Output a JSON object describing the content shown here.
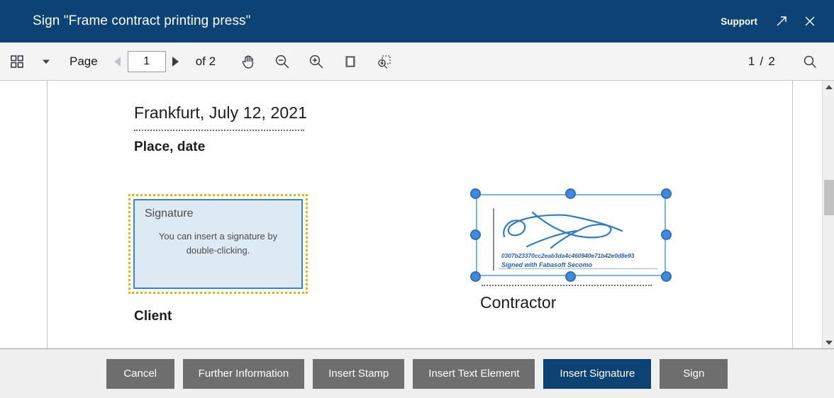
{
  "window": {
    "title": "Sign \"Frame contract printing press\"",
    "support_label": "Support",
    "popout_icon": "external-link-icon",
    "close_icon": "close-icon",
    "accent_color": "#0b4375"
  },
  "toolbar": {
    "grid_icon": "thumbnail-grid-icon",
    "dropdown_icon": "chevron-down-icon",
    "page_label": "Page",
    "prev_icon": "previous-page-icon",
    "page_value": "1",
    "next_icon": "next-page-icon",
    "of_label": "of 2",
    "pan_icon": "hand-pan-icon",
    "zoom_out_icon": "zoom-out-icon",
    "zoom_in_icon": "zoom-in-icon",
    "page_view_icon": "single-page-view-icon",
    "marquee_zoom_icon": "zoom-selection-icon",
    "page_indicator": "1 / 2",
    "search_icon": "search-icon"
  },
  "document": {
    "date_value": "Frankfurt, July 12, 2021",
    "place_date_caption": "Place, date",
    "signature_placeholder": {
      "title": "Signature",
      "hint": "You can insert a signature by double-clicking.",
      "border_color": "#e8b300",
      "inner_border_color": "#3a87c8",
      "fill_color": "#ddeaf4"
    },
    "client_caption": "Client",
    "applied_signature": {
      "hash": "0307b23370cc2eab3da4c460940e71b42e0d8e93",
      "signed_with": "Signed with Fabasoft Secomo",
      "ink_color": "#2f7dc4",
      "handle_color": "#3f8ae0"
    },
    "contractor_caption": "Contractor"
  },
  "scrollbar": {
    "up_icon": "scroll-up-icon",
    "down_icon": "scroll-down-icon",
    "thumb": "scroll-thumb"
  },
  "buttons": [
    {
      "label": "Cancel",
      "name": "cancel-button",
      "primary": false
    },
    {
      "label": "Further Information",
      "name": "further-information-button",
      "primary": false
    },
    {
      "label": "Insert Stamp",
      "name": "insert-stamp-button",
      "primary": false
    },
    {
      "label": "Insert Text Element",
      "name": "insert-text-element-button",
      "primary": false
    },
    {
      "label": "Insert Signature",
      "name": "insert-signature-button",
      "primary": true
    },
    {
      "label": "Sign",
      "name": "sign-button",
      "primary": false
    }
  ]
}
